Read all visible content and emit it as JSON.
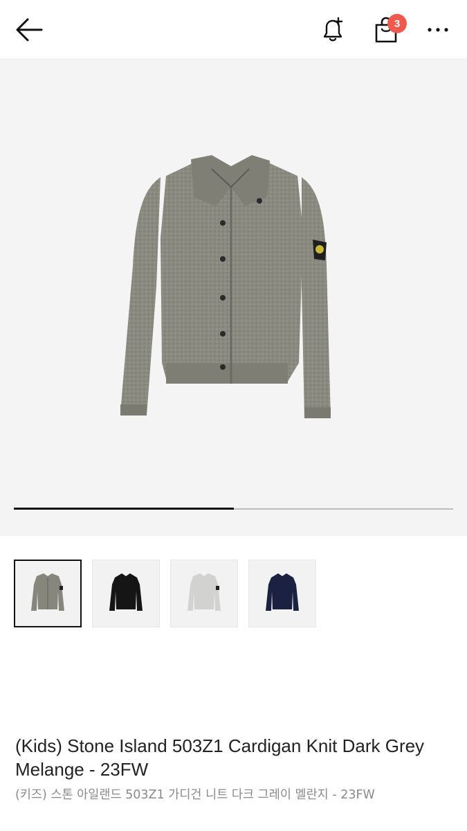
{
  "header": {
    "back_icon": "arrow-left-icon",
    "bell_icon": "bell-plus-icon",
    "cart_icon": "shopping-bag-icon",
    "cart_count": "3",
    "more_icon": "more-horizontal-icon",
    "badge_color": "#ef5a4f"
  },
  "gallery": {
    "progress": 0.5,
    "thumbnails": [
      {
        "color": "grey-melange",
        "selected": true
      },
      {
        "color": "black",
        "selected": false
      },
      {
        "color": "light-grey",
        "selected": false
      },
      {
        "color": "navy",
        "selected": false
      }
    ]
  },
  "product": {
    "title": "(Kids) Stone Island 503Z1 Cardigan Knit Dark Grey Melange - 23FW",
    "subtitle": "(키즈) 스톤 아일랜드 503Z1 가디건 니트 다크 그레이 멜란지 - 23FW"
  }
}
